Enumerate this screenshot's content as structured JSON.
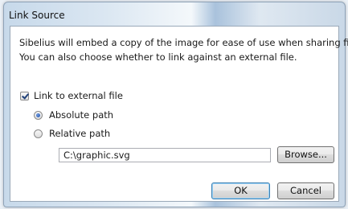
{
  "window": {
    "title": "Link Source"
  },
  "description": {
    "line1": "Sibelius will embed a copy of the image for ease of use when sharing files.",
    "line2": "You can also choose whether to link against an external file."
  },
  "link_checkbox": {
    "label": "Link to external file",
    "checked": true
  },
  "path_options": [
    {
      "label": "Absolute path",
      "selected": true
    },
    {
      "label": "Relative path",
      "selected": false
    }
  ],
  "path_field": {
    "value": "C:\\graphic.svg"
  },
  "buttons": {
    "browse": "Browse...",
    "ok": "OK",
    "cancel": "Cancel"
  }
}
